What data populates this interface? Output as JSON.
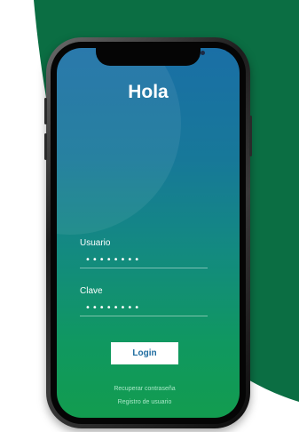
{
  "colors": {
    "background_shape": "#0b6e43",
    "screen_top": "#1a6fa6",
    "screen_bottom": "#129c4f",
    "button_text": "#1e6ca0",
    "link_text": "#a9e7c7"
  },
  "login": {
    "greeting": "Hola",
    "username_label": "Usuario",
    "username_value": "••••••••",
    "password_label": "Clave",
    "password_value": "••••••••",
    "login_button": "Login",
    "recover_link": "Recuperar contraseña",
    "register_link": "Registro de usuario"
  }
}
